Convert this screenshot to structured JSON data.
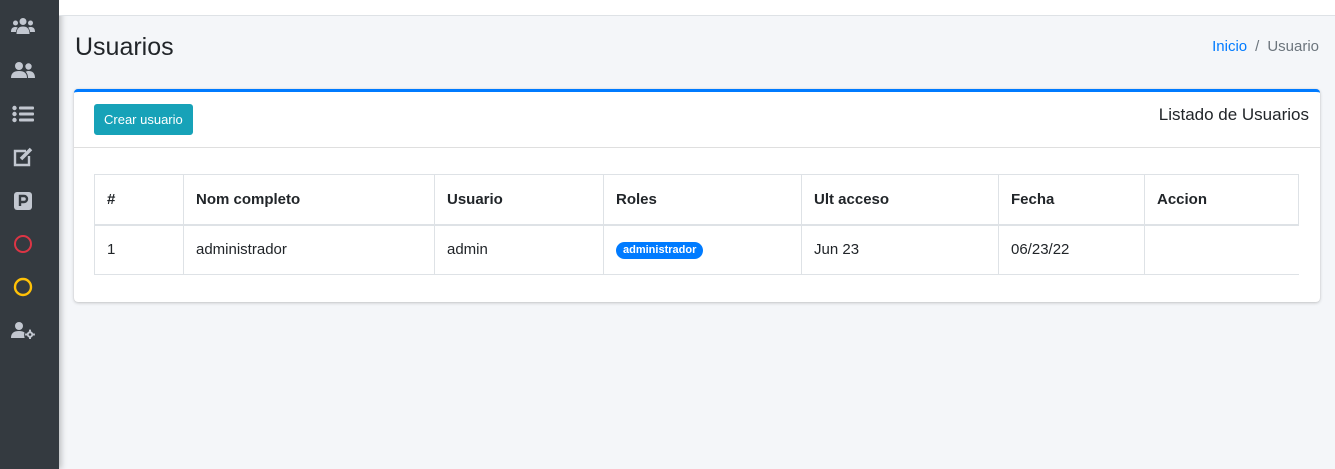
{
  "sidebar": {
    "items": [
      {
        "icon": "users-group-icon"
      },
      {
        "icon": "user-friends-icon"
      },
      {
        "icon": "list-icon"
      },
      {
        "icon": "edit-icon"
      },
      {
        "icon": "parking-icon"
      },
      {
        "icon": "circle-icon",
        "color": "#dc3545"
      },
      {
        "icon": "circle-icon",
        "color": "#ffc107"
      },
      {
        "icon": "users-cog-icon"
      }
    ]
  },
  "header": {
    "title": "Usuarios",
    "breadcrumb": {
      "home": "Inicio",
      "separator": "/",
      "current": "Usuario"
    }
  },
  "card": {
    "create_button": "Crear usuario",
    "title": "Listado de Usuarios"
  },
  "table": {
    "headers": [
      "#",
      "Nom completo",
      "Usuario",
      "Roles",
      "Ult acceso",
      "Fecha",
      "Accion"
    ],
    "rows": [
      {
        "num": "1",
        "nombre": "administrador",
        "usuario": "admin",
        "rol": "administrador",
        "ult_acceso": "Jun 23",
        "fecha": "06/23/22",
        "accion": ""
      }
    ]
  },
  "colors": {
    "sidebar_bg": "#343a40",
    "primary": "#007bff",
    "info": "#17a2b8",
    "page_bg": "#f4f6f9"
  }
}
